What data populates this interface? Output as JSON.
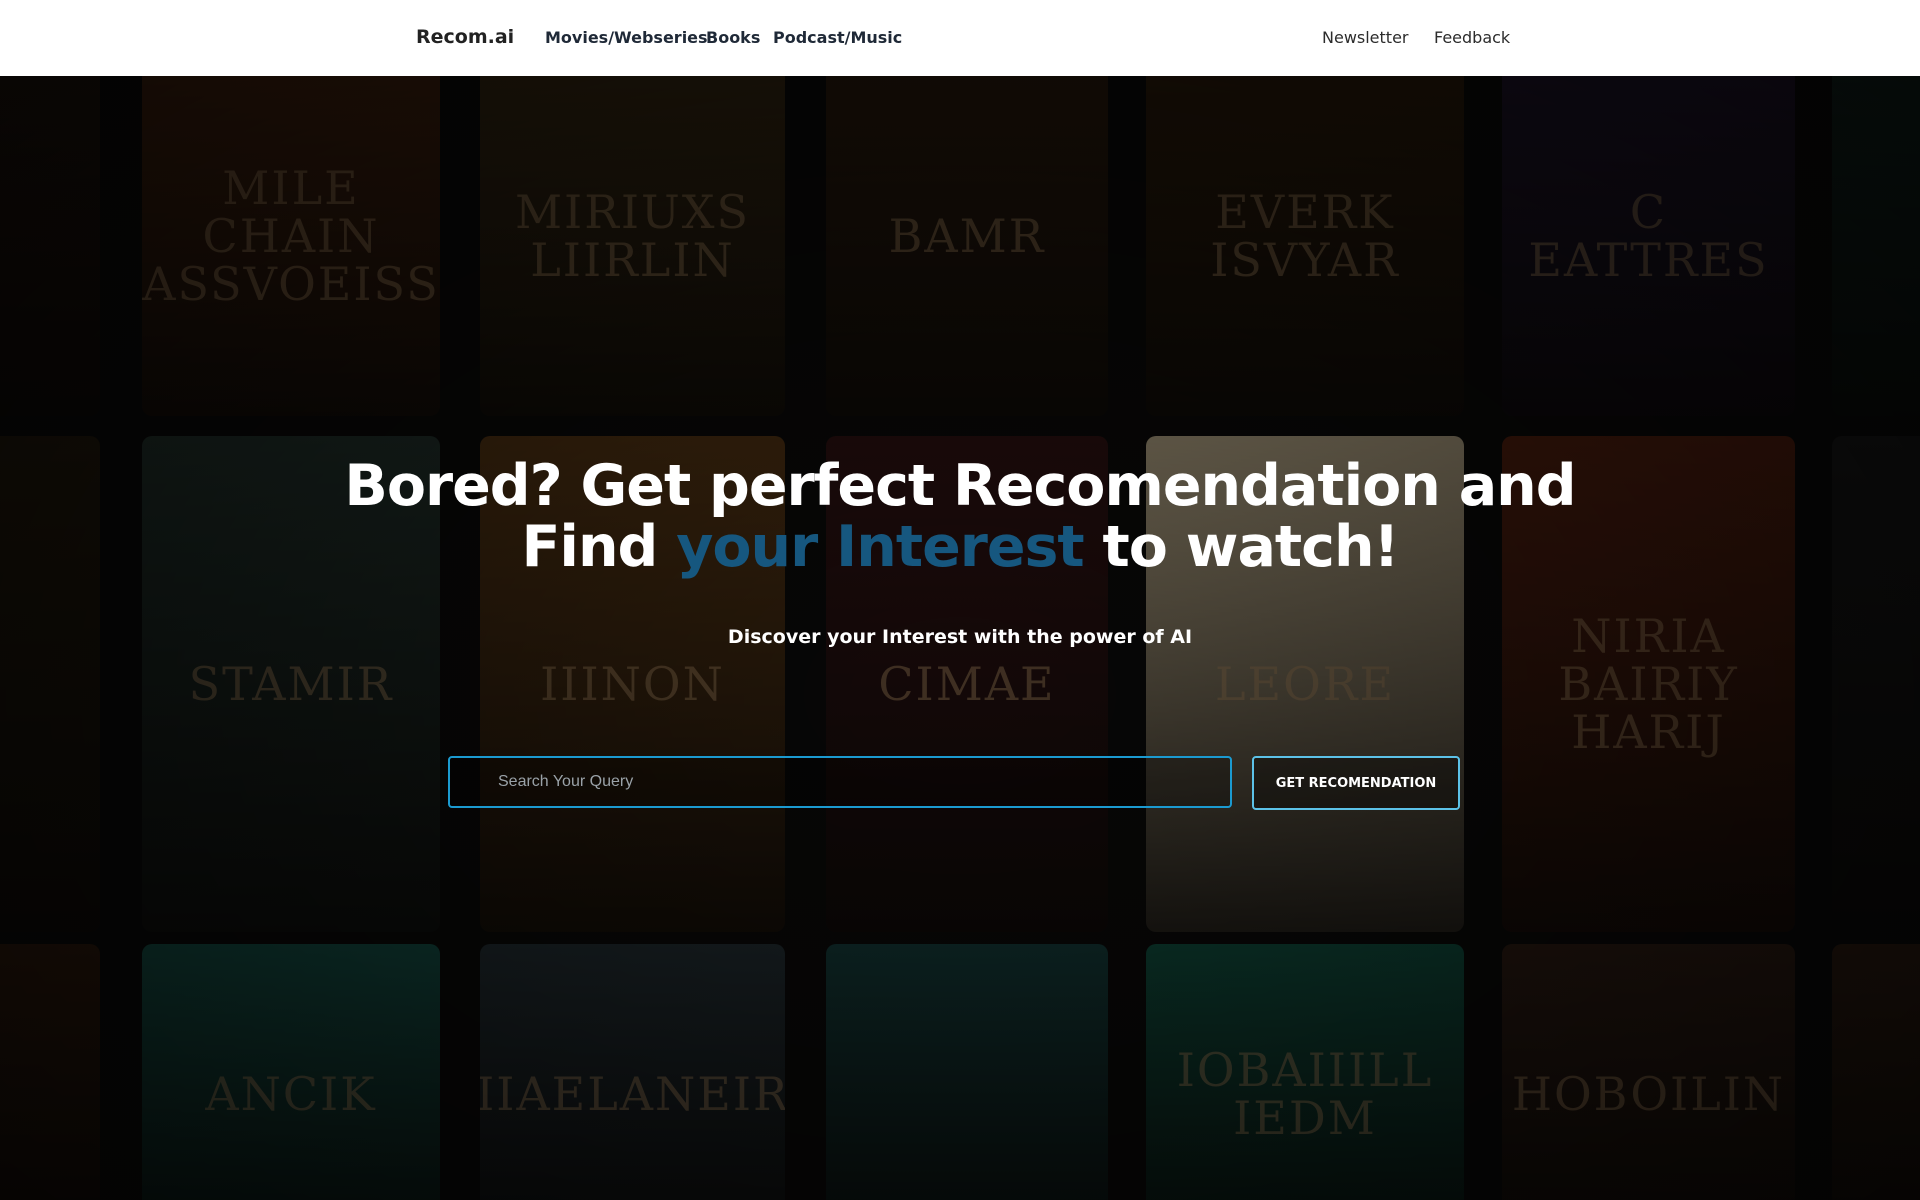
{
  "navbar": {
    "brand": "Recom.ai",
    "links": [
      "Movies/Webseries",
      "Books",
      "Podcast/Music"
    ],
    "right_links": [
      "Newsletter",
      "Feedback"
    ]
  },
  "hero": {
    "headline_line1": "Bored? Get perfect Recomendation and",
    "headline_find": "Find",
    "headline_accent": "your Interest",
    "headline_end": "to watch!",
    "accent_color": "#16577f",
    "subtitle": "Discover your Interest with the power of AI",
    "search": {
      "placeholder": "Search Your Query",
      "value": ""
    },
    "button_label": "GET RECOMENDATION"
  },
  "background_covers": [
    {
      "text": "",
      "bg": "#2a1a10"
    },
    {
      "text": "MILE CHAIN ASSVOEISS",
      "bg": "#5a2e14"
    },
    {
      "text": "MIRIUXS LIIRLIN",
      "bg": "#4a3618"
    },
    {
      "text": "BAMR",
      "bg": "#3a2412"
    },
    {
      "text": "EVERK ISVYAR",
      "bg": "#3c2610"
    },
    {
      "text": "C EATTRES",
      "bg": "#2a1c3a"
    },
    {
      "text": "",
      "bg": "#183028"
    },
    {
      "text": "",
      "bg": "#2c2010"
    },
    {
      "text": "STAMIR",
      "bg": "#2c4038"
    },
    {
      "text": "IIINON",
      "bg": "#6a4218"
    },
    {
      "text": "CIMAE",
      "bg": "#3a1616"
    },
    {
      "text": "LEORE",
      "bg": "#e2cfa8"
    },
    {
      "text": "NIRIA BAIRIY HARIJ",
      "bg": "#6a2812"
    },
    {
      "text": "",
      "bg": "#1e1e1e"
    },
    {
      "text": "",
      "bg": "#3a2010"
    },
    {
      "text": "ANCIK",
      "bg": "#1a6458"
    },
    {
      "text": "KIIAELANEIRE",
      "bg": "#2c3a40"
    },
    {
      "text": "",
      "bg": "#1a4a48"
    },
    {
      "text": "IOBAIIILL IEDM",
      "bg": "#14624e"
    },
    {
      "text": "HOBOILIN",
      "bg": "#3a2418"
    },
    {
      "text": "",
      "bg": "#3a2416"
    }
  ]
}
